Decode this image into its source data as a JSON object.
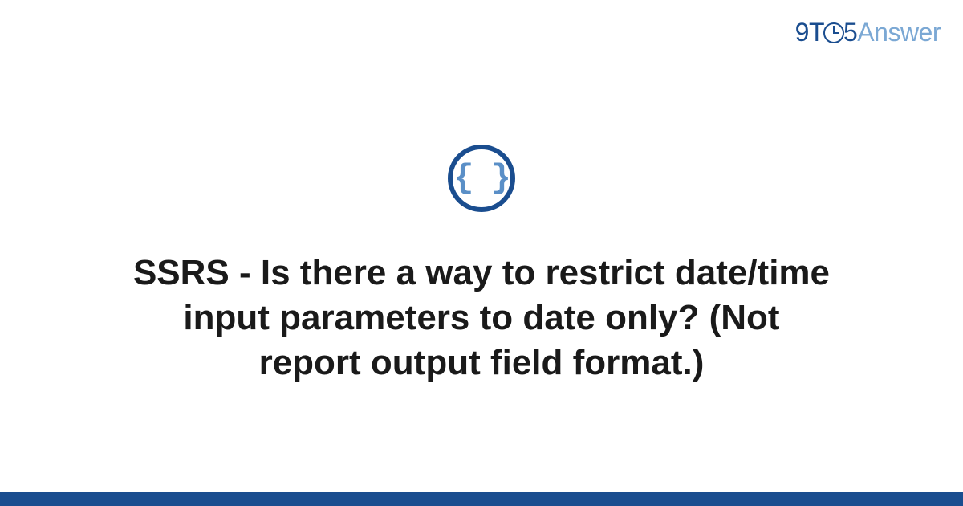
{
  "logo": {
    "part1": "9T",
    "part2": "5",
    "part3": "Answer"
  },
  "badge": {
    "symbol": "{ }",
    "name": "code-braces"
  },
  "question": {
    "title": "SSRS - Is there a way to restrict date/time input parameters to date only? (Not report output field format.)"
  },
  "colors": {
    "brand_primary": "#1a4d8f",
    "brand_secondary": "#7ba8d4",
    "badge_inner": "#5a8fc7"
  }
}
